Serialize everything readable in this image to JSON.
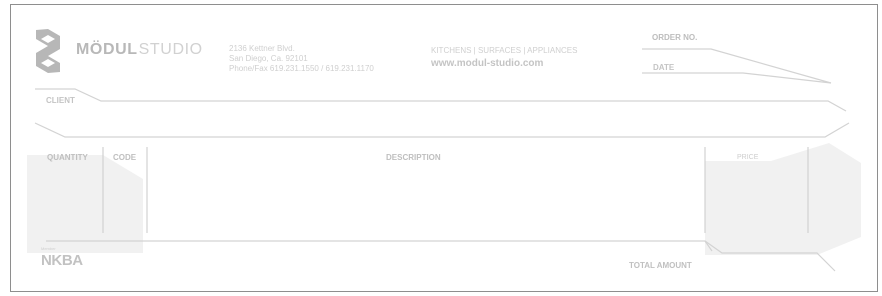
{
  "brand": {
    "name_bold": "MÖDUL",
    "name_light": "STUDIO",
    "address_lines": [
      "2136 Kettner Blvd.",
      "San Diego, Ca. 92101",
      "Phone/Fax 619.231.1550 / 619.231.1170"
    ],
    "tagline": "KITCHENS | SURFACES | APPLIANCES",
    "website": "www.modul-studio.com",
    "logo_icon": "modul-s-logo-icon"
  },
  "fields": {
    "order_no": "ORDER NO.",
    "date": "DATE",
    "client": "CLIENT",
    "total_amount": "TOTAL AMOUNT"
  },
  "table": {
    "columns": [
      "QUANTITY",
      "CODE",
      "DESCRIPTION",
      "PRICE"
    ]
  },
  "partner": {
    "label": "Member",
    "name": "NKBA"
  },
  "colors": {
    "border": "#8e8e8e",
    "line": "#d3d3d3",
    "text": "#c7c7c7",
    "watermark": "#f1f1f1"
  }
}
